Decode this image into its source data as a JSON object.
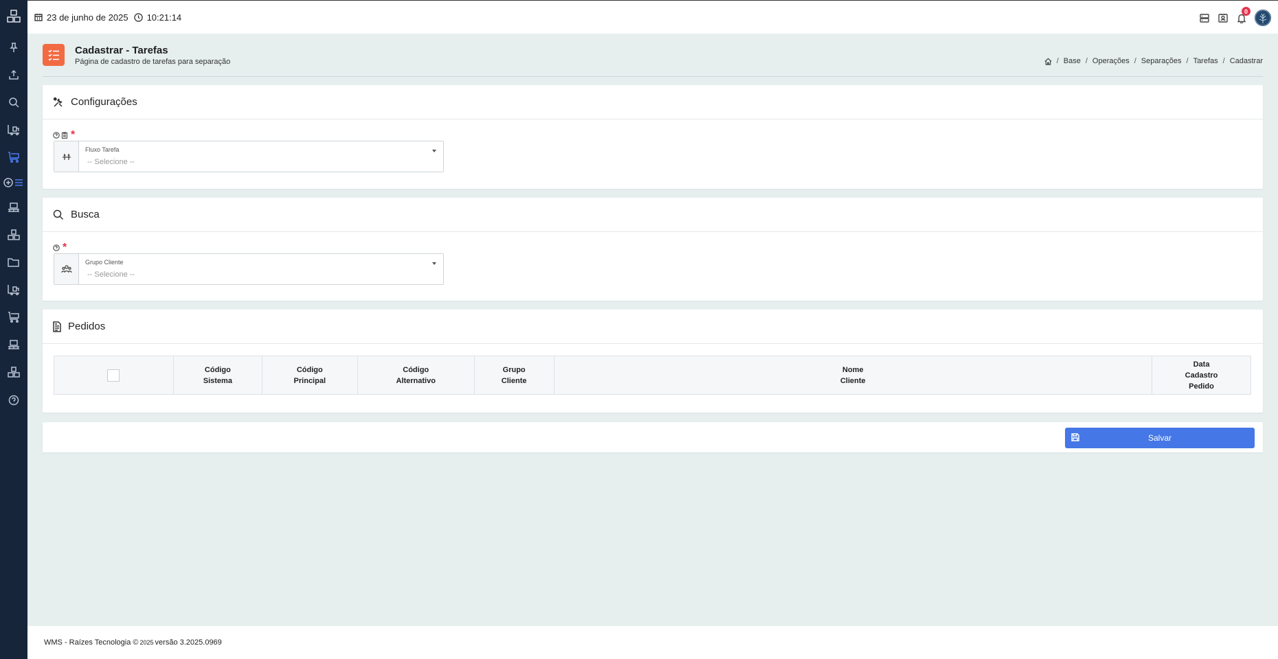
{
  "topbar": {
    "date": "23 de junho de 2025",
    "time": "10:21:14",
    "notification_count": "0"
  },
  "sidebar": {
    "items": [
      {
        "icon": "pin-icon"
      },
      {
        "icon": "upload-icon"
      },
      {
        "icon": "search-icon"
      },
      {
        "icon": "forklift-icon"
      },
      {
        "icon": "cart-icon",
        "active": true
      },
      {
        "icon": "add-list-icon"
      },
      {
        "icon": "pallet-icon"
      },
      {
        "icon": "boxes-icon"
      },
      {
        "icon": "folder-icon"
      },
      {
        "icon": "forklift-icon"
      },
      {
        "icon": "cart-icon"
      },
      {
        "icon": "pallet-icon"
      },
      {
        "icon": "boxes-icon"
      },
      {
        "icon": "help-icon"
      }
    ]
  },
  "header": {
    "title": "Cadastrar - Tarefas",
    "subtitle": "Página de cadastro de tarefas para separação",
    "breadcrumb": [
      "Base",
      "Operações",
      "Separações",
      "Tarefas",
      "Cadastrar"
    ]
  },
  "config": {
    "title": "Configurações",
    "field_label": "Fluxo Tarefa",
    "field_value": "-- Selecione --"
  },
  "search": {
    "title": "Busca",
    "field_label": "Grupo Cliente",
    "field_value": "-- Selecione --"
  },
  "orders": {
    "title": "Pedidos",
    "columns": [
      {
        "l1": "Código",
        "l2": "Sistema"
      },
      {
        "l1": "Código",
        "l2": "Principal"
      },
      {
        "l1": "Código",
        "l2": "Alternativo"
      },
      {
        "l1": "Grupo",
        "l2": "Cliente"
      },
      {
        "l1": "Nome",
        "l2": "Cliente"
      },
      {
        "l1": "Data",
        "l2": "Cadastro",
        "l3": "Pedido"
      }
    ]
  },
  "actions": {
    "save_label": "Salvar"
  },
  "footer": {
    "prefix": "WMS - Raízes Tecnologia ©",
    "year": "2025",
    "version": "versão 3.2025.0969"
  },
  "colors": {
    "sidebar": "#16253a",
    "accent": "#4577e6",
    "header_icon": "#f26a43",
    "required": "#e5344c"
  }
}
